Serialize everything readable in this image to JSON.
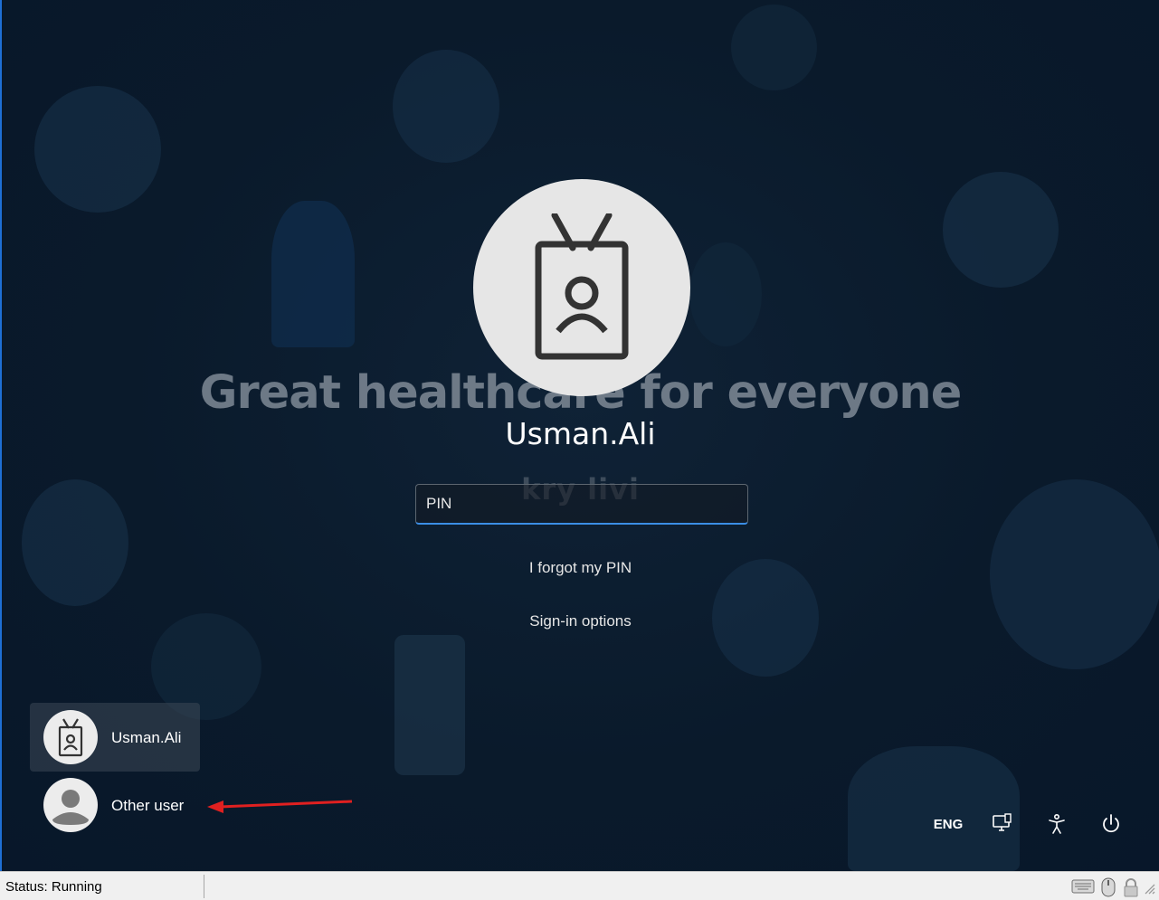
{
  "lock_screen": {
    "tagline": "Great healthcare for everyone",
    "tagline_secondary": "kry  livi",
    "username": "Usman.Ali",
    "pin_placeholder": "PIN",
    "forgot_pin": "I forgot my PIN",
    "signin_options": "Sign-in options",
    "avatar_icon": "id-badge-icon"
  },
  "user_list": [
    {
      "label": "Usman.Ali",
      "icon": "id-badge-icon",
      "selected": true
    },
    {
      "label": "Other user",
      "icon": "generic-user-icon",
      "selected": false
    }
  ],
  "system_tray": {
    "language": "ENG",
    "network_icon": "network-icon",
    "accessibility_icon": "accessibility-icon",
    "power_icon": "power-icon"
  },
  "vm_statusbar": {
    "status": "Status: Running"
  },
  "colors": {
    "accent": "#3b8ee5",
    "annotation_arrow": "#e02020",
    "background": "#0a1a2b"
  }
}
